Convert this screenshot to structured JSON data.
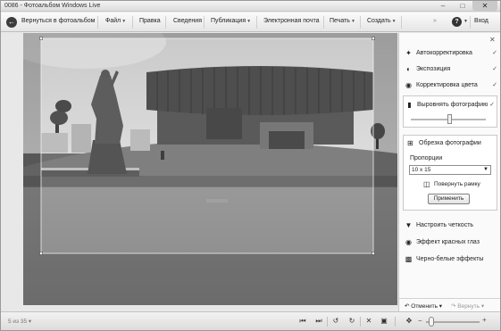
{
  "window": {
    "title": "0086 - Фотоальбом Windows Live",
    "minimize_icon": "minimize-icon",
    "maximize_icon": "maximize-icon",
    "close_label": "✕"
  },
  "menu": {
    "back_label": "Вернуться в фотоальбом",
    "items": [
      {
        "label": "Файл",
        "dropdown": true
      },
      {
        "label": "Правка",
        "dropdown": false
      },
      {
        "label": "Сведения",
        "dropdown": false
      },
      {
        "label": "Публикация",
        "dropdown": true
      },
      {
        "label": "Электронная почта",
        "dropdown": false
      },
      {
        "label": "Печать",
        "dropdown": true
      },
      {
        "label": "Создать",
        "dropdown": true
      }
    ],
    "signin_label": "Вход"
  },
  "panel": {
    "tools": [
      {
        "label": "Автокорректировка",
        "icon": "magic-wand-icon",
        "applied": true
      },
      {
        "label": "Экспозиция",
        "icon": "exposure-icon",
        "applied": true
      },
      {
        "label": "Корректировка цвета",
        "icon": "color-icon",
        "applied": true
      },
      {
        "label": "Выровнять фотографию",
        "icon": "straighten-icon",
        "applied": true
      }
    ],
    "straighten_level": 0.52,
    "crop": {
      "title": "Обрезка фотографии",
      "proportion_label": "Пропорции",
      "proportion_value": "10 x 15",
      "rotate_label": "Повернуть рамку",
      "apply_label": "Применить"
    },
    "extra_tools": [
      {
        "label": "Настроить четкость",
        "icon": "sharpen-icon"
      },
      {
        "label": "Эффект красных глаз",
        "icon": "red-eye-icon"
      },
      {
        "label": "Черно-белые эффекты",
        "icon": "bw-effects-icon"
      }
    ],
    "undo_label": "Отменить",
    "redo_label": "Вернуть"
  },
  "status": {
    "count": "5 из 35"
  },
  "colors": {
    "accent": "#3c3c3c",
    "panel_bg": "#fafafa"
  }
}
